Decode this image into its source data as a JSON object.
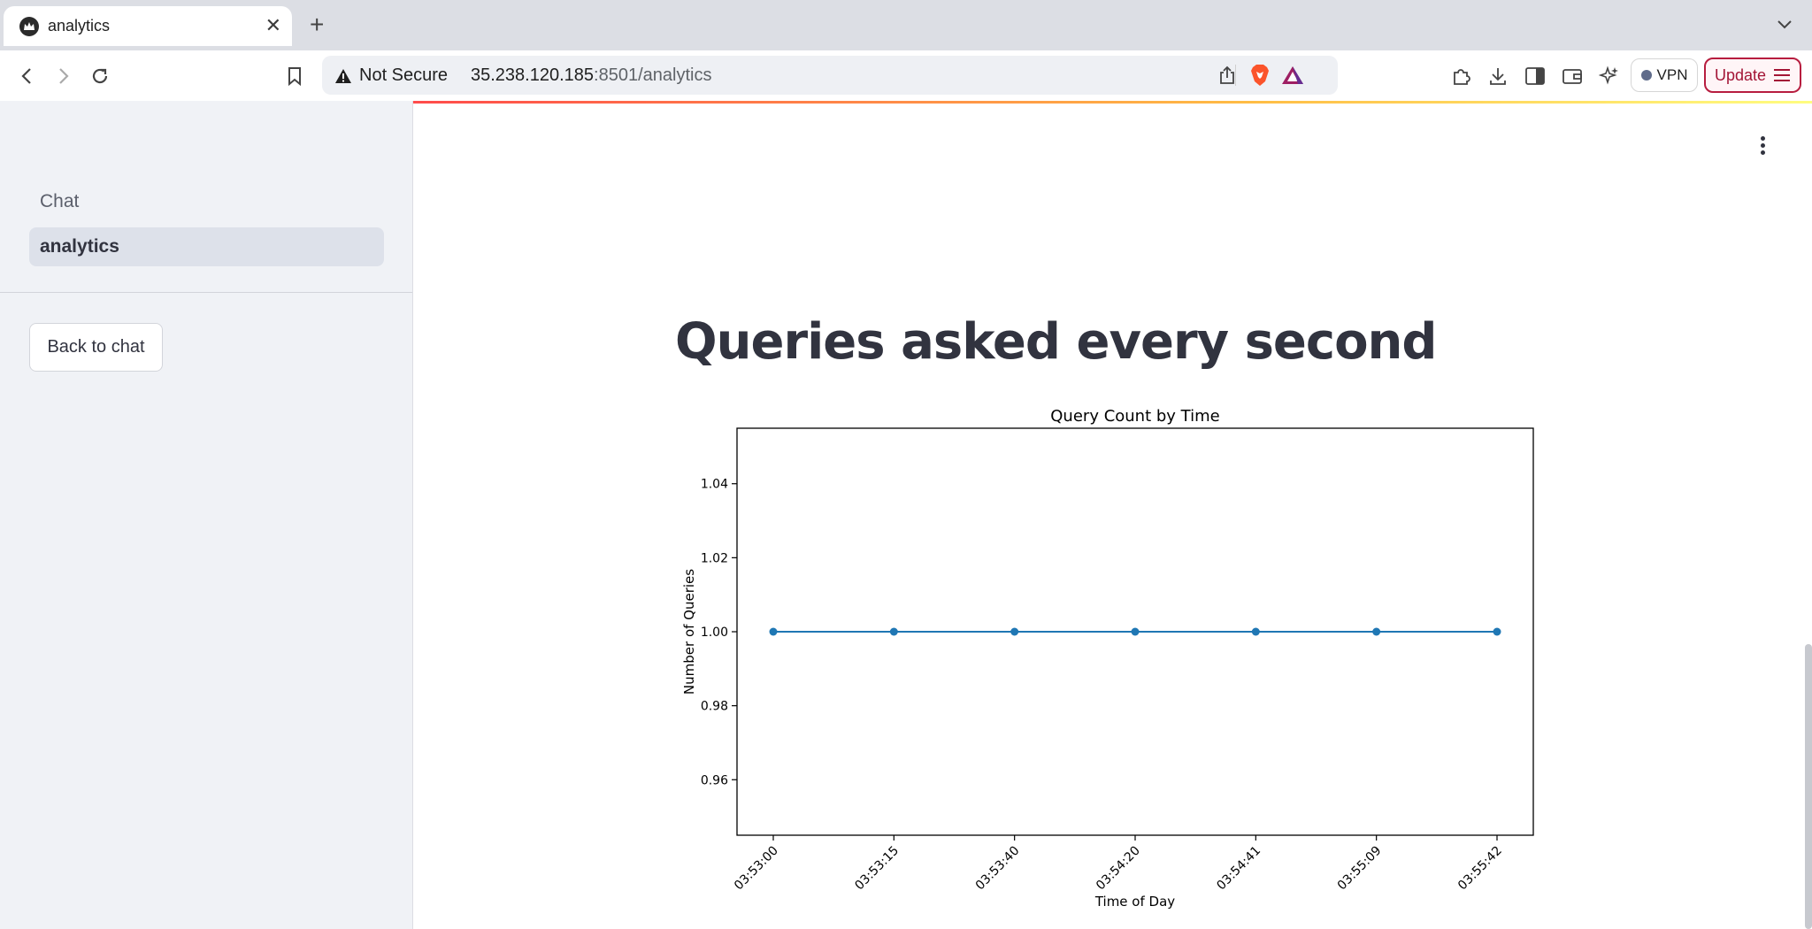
{
  "browser": {
    "tab_title": "analytics",
    "security_label": "Not Secure",
    "url_host": "35.238.120.185",
    "url_path": ":8501/analytics",
    "vpn_label": "VPN",
    "update_label": "Update"
  },
  "sidebar": {
    "items": [
      {
        "label": "Chat",
        "active": false
      },
      {
        "label": "analytics",
        "active": true
      }
    ],
    "back_button": "Back to chat"
  },
  "main": {
    "title": "Queries asked every second"
  },
  "colors": {
    "line": "#1f77b4",
    "accent_red": "#ff4b4b",
    "update_border": "#b71d3f"
  },
  "chart_data": {
    "type": "line",
    "title": "Query Count by Time",
    "xlabel": "Time of Day",
    "ylabel": "Number of Queries",
    "categories": [
      "03:53:00",
      "03:53:15",
      "03:53:40",
      "03:54:20",
      "03:54:41",
      "03:55:09",
      "03:55:42"
    ],
    "series": [
      {
        "values": [
          1,
          1,
          1,
          1,
          1,
          1,
          1
        ]
      }
    ],
    "ylim": [
      0.945,
      1.055
    ],
    "yticks": [
      0.96,
      0.98,
      1.0,
      1.02,
      1.04
    ],
    "ytick_labels": [
      "0.96",
      "0.98",
      "1.00",
      "1.02",
      "1.04"
    ],
    "grid": false,
    "legend": "none",
    "markers": true
  }
}
